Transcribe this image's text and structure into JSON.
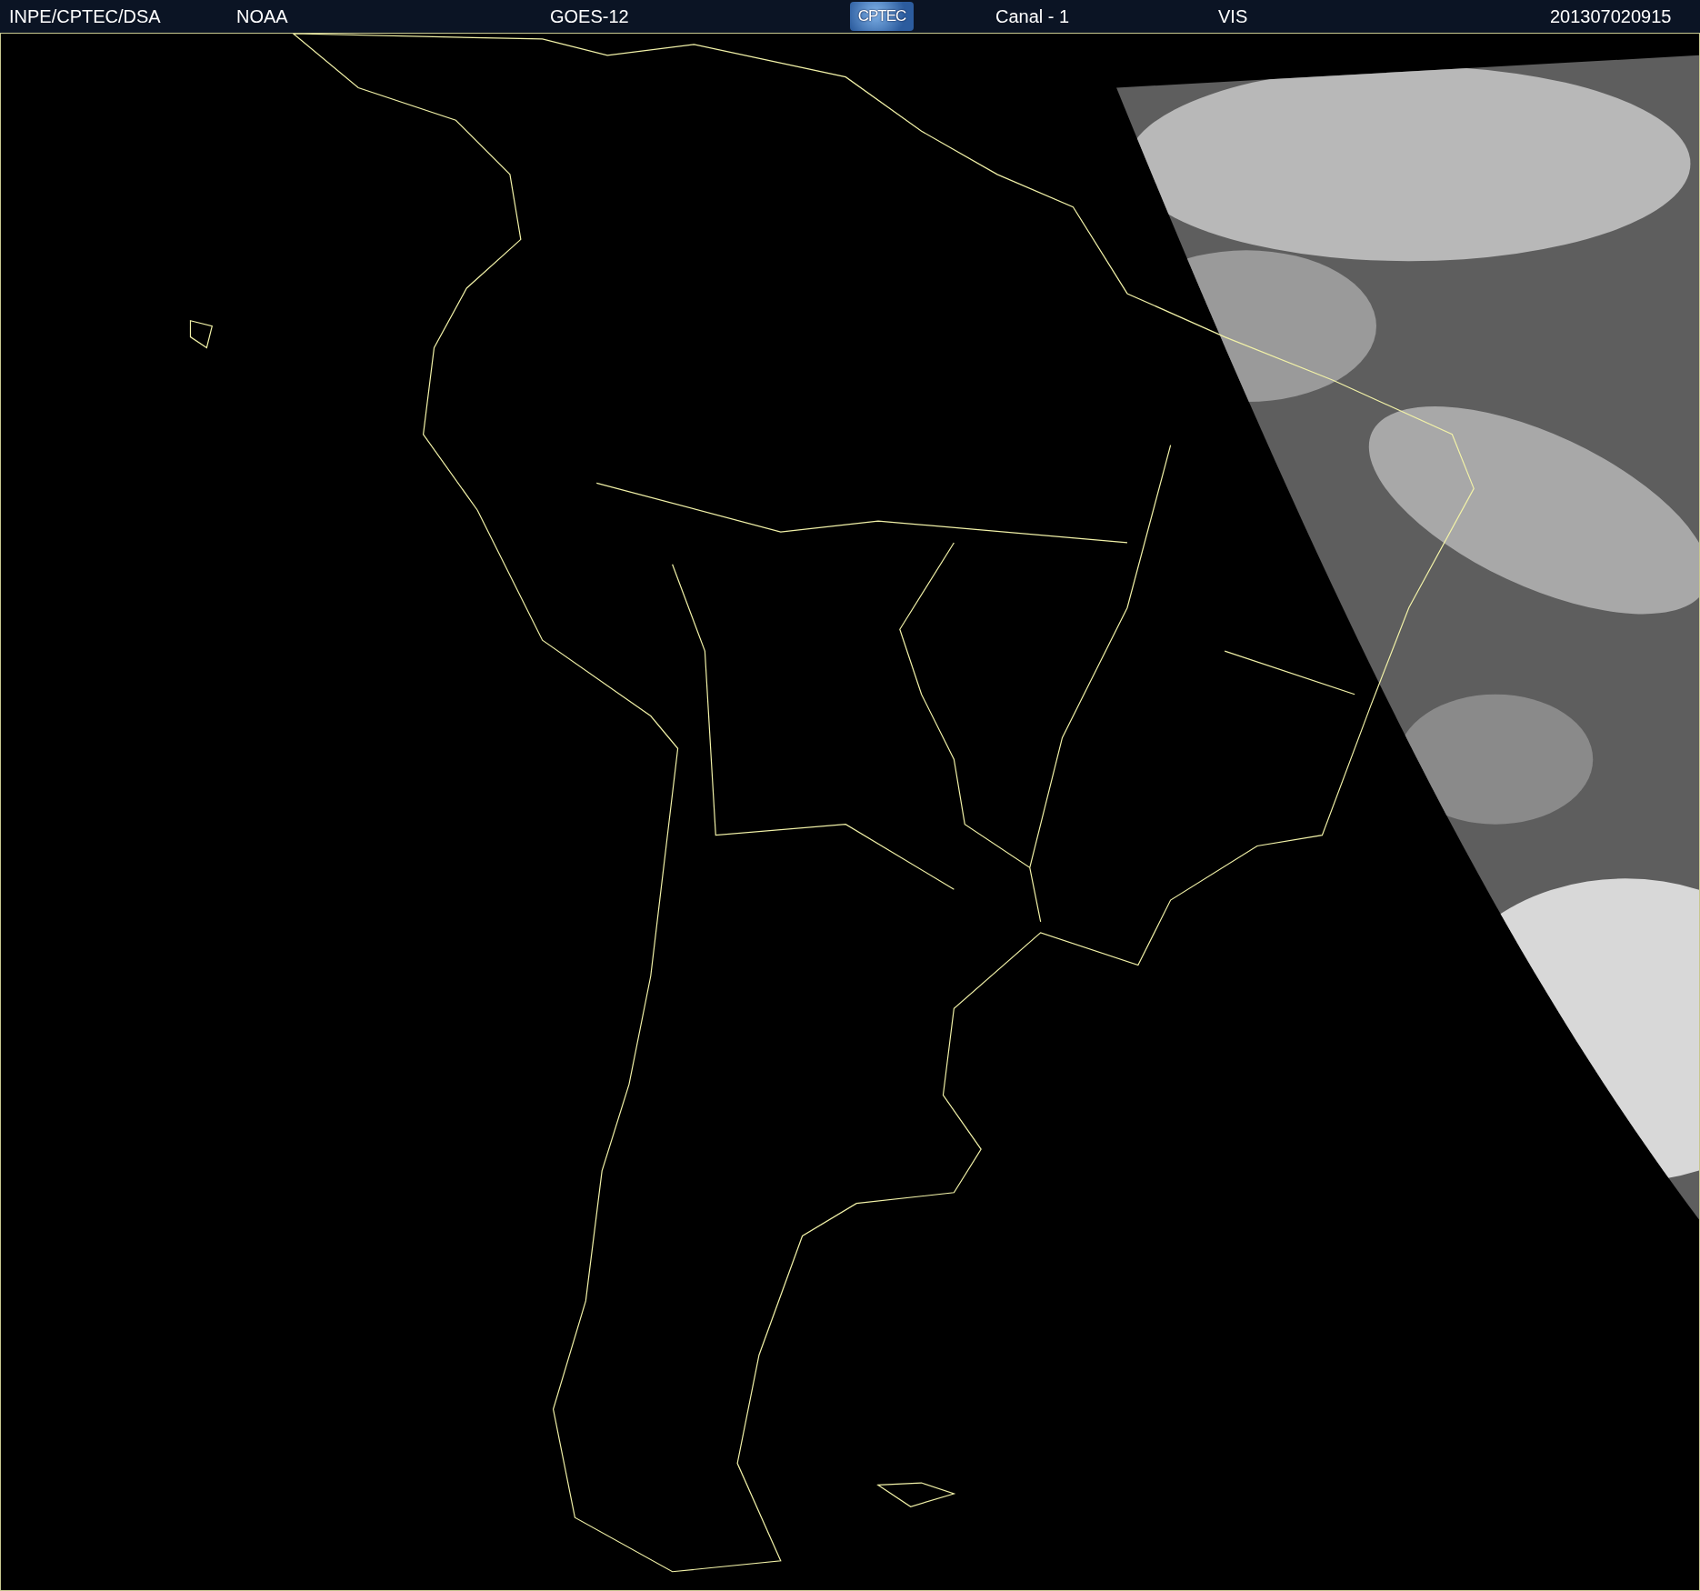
{
  "header": {
    "items": [
      {
        "kind": "text",
        "text": "INPE/CPTEC/DSA"
      },
      {
        "kind": "text",
        "text": "NOAA"
      },
      {
        "kind": "text",
        "text": "GOES-12"
      },
      {
        "kind": "logo",
        "text": "CPTEC"
      },
      {
        "kind": "text",
        "text": "Canal - 1"
      },
      {
        "kind": "text",
        "text": "VIS"
      },
      {
        "kind": "text",
        "text": "201307020915"
      }
    ]
  }
}
